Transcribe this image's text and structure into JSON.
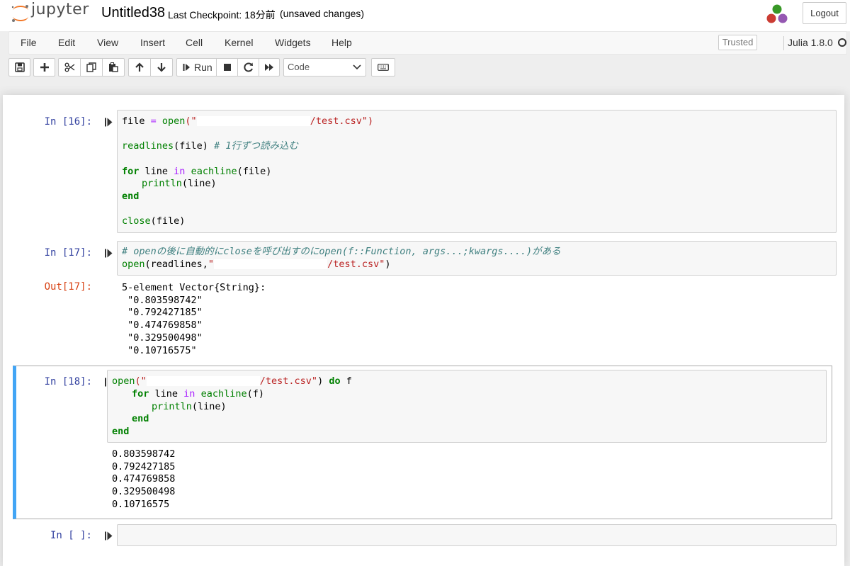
{
  "header": {
    "logo_text": "jupyter",
    "notebook_name": "Untitled38",
    "checkpoint": "Last Checkpoint: 18分前",
    "autosave_status": "(unsaved changes)",
    "logout_label": "Logout"
  },
  "menubar": {
    "items": [
      "File",
      "Edit",
      "View",
      "Insert",
      "Cell",
      "Kernel",
      "Widgets",
      "Help"
    ],
    "trusted_label": "Trusted",
    "kernel_name": "Julia 1.8.0"
  },
  "toolbar": {
    "run_label": "Run",
    "cell_type": "Code",
    "icons": [
      "save-icon",
      "plus-icon",
      "cut-icon",
      "copy-icon",
      "paste-icon",
      "arrow-up-icon",
      "arrow-down-icon",
      "play-step-icon",
      "stop-icon",
      "restart-icon",
      "fast-forward-icon",
      "keyboard-icon"
    ]
  },
  "cells": [
    {
      "prompt": "In [16]:",
      "lines": [
        [
          "file ",
          "= ",
          "open",
          "(\"",
          "/test.csv\")"
        ],
        [
          "readlines",
          "(file) ",
          "# 1行ずつ読み込む"
        ],
        [
          "for",
          " line ",
          "in",
          " ",
          "eachline",
          "(file)"
        ],
        [
          "println",
          "(line)"
        ],
        [
          "end"
        ],
        [
          "close",
          "(file)"
        ]
      ]
    },
    {
      "prompt": "In [17]:",
      "lines": [
        [
          "# openの後に自動的にcloseを呼び出すのにopen(f::Function, args...;kwargs....)がある"
        ],
        [
          "open",
          "(readlines,",
          "\"",
          "/test.csv\"",
          ")"
        ]
      ],
      "output_prompt": "Out[17]:",
      "output": "5-element Vector{String}:\n \"0.803598742\"\n \"0.792427185\"\n \"0.474769858\"\n \"0.329500498\"\n \"0.10716575\""
    },
    {
      "prompt": "In [18]:",
      "lines": [
        [
          "open",
          "(\"",
          "/test.csv\"",
          ") ",
          "do",
          " f"
        ],
        [
          "for",
          " line ",
          "in",
          " ",
          "eachline",
          "(f)"
        ],
        [
          "println",
          "(line)"
        ],
        [
          "end"
        ],
        [
          "end"
        ]
      ],
      "output": "0.803598742\n0.792427185\n0.474769858\n0.329500498\n0.10716575"
    },
    {
      "prompt": "In [ ]:"
    }
  ]
}
